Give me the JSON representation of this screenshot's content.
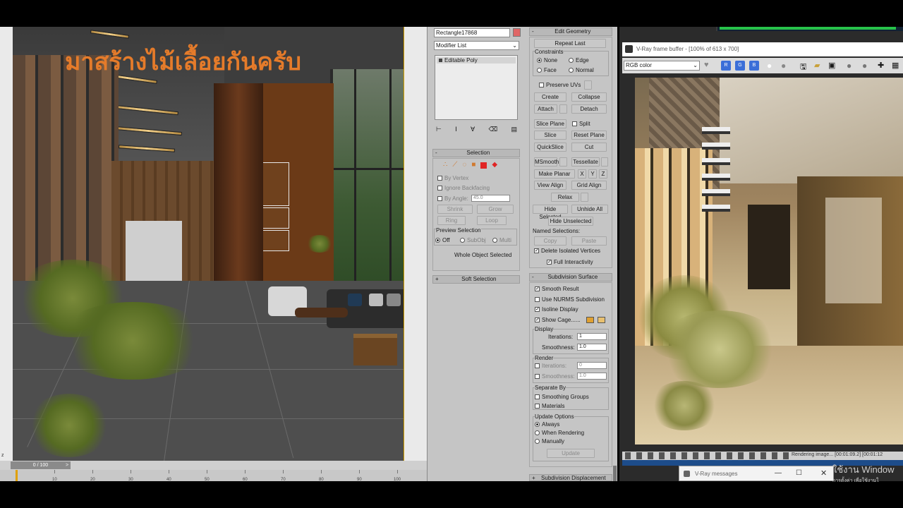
{
  "viewport": {
    "overlay_title": "มาสร้างไม้เลื้อยกันครับ",
    "axis_label": "z"
  },
  "timeline": {
    "frame_indicator": "0 / 100",
    "next_arrow": ">",
    "ticks": [
      "10",
      "20",
      "30",
      "40",
      "50",
      "60",
      "70",
      "80",
      "90",
      "100"
    ]
  },
  "command_panel": {
    "object_name": "Rectangle17868",
    "object_color": "#e06666",
    "modifier_list_label": "Modifier List",
    "modifier_stack": [
      "Editable Poly"
    ],
    "selection": {
      "title": "Selection",
      "by_vertex": "By Vertex",
      "ignore_backfacing": "Ignore Backfacing",
      "by_angle": "By Angle:",
      "by_angle_value": "45.0",
      "shrink": "Shrink",
      "grow": "Grow",
      "ring": "Ring",
      "loop": "Loop",
      "preview_selection": "Preview Selection",
      "preview_off": "Off",
      "preview_subobj": "SubObj",
      "preview_multi": "Multi",
      "status": "Whole Object Selected"
    },
    "soft_selection": {
      "title": "Soft Selection"
    },
    "edit_geometry": {
      "title": "Edit Geometry",
      "repeat_last": "Repeat Last",
      "constraints": "Constraints",
      "none": "None",
      "edge": "Edge",
      "face": "Face",
      "normal": "Normal",
      "preserve_uvs": "Preserve UVs",
      "create": "Create",
      "collapse": "Collapse",
      "attach": "Attach",
      "detach": "Detach",
      "slice_plane": "Slice Plane",
      "split": "Split",
      "slice": "Slice",
      "reset_plane": "Reset Plane",
      "quickslice": "QuickSlice",
      "cut": "Cut",
      "msmooth": "MSmooth",
      "tessellate": "Tessellate",
      "make_planar": "Make Planar",
      "x": "X",
      "y": "Y",
      "z": "Z",
      "view_align": "View Align",
      "grid_align": "Grid Align",
      "relax": "Relax",
      "hide_selected": "Hide Selected",
      "unhide_all": "Unhide All",
      "hide_unselected": "Hide Unselected",
      "named_selections": "Named Selections:",
      "copy": "Copy",
      "paste": "Paste",
      "delete_isolated": "Delete Isolated Vertices",
      "full_interactivity": "Full Interactivity"
    },
    "subdivision_surface": {
      "title": "Subdivision Surface",
      "smooth_result": "Smooth Result",
      "use_nurms": "Use NURMS Subdivision",
      "isoline_display": "Isoline Display",
      "show_cage": "Show Cage......",
      "cage_color_1": "#e0a030",
      "cage_color_2": "#e8c070",
      "display": "Display",
      "iterations": "Iterations:",
      "iterations_value": "1",
      "smoothness": "Smoothness:",
      "smoothness_value": "1.0",
      "render": "Render",
      "render_iterations": "Iterations:",
      "render_iterations_value": "0",
      "render_smoothness": "Smoothness:",
      "render_smoothness_value": "1.0",
      "separate_by": "Separate By",
      "smoothing_groups": "Smoothing Groups",
      "materials": "Materials",
      "update_options": "Update Options",
      "always": "Always",
      "when_rendering": "When Rendering",
      "manually": "Manually",
      "update": "Update"
    },
    "subdivision_displacement": {
      "title": "Subdivision Displacement"
    }
  },
  "vfb": {
    "title": "V-Ray frame buffer - [100% of 613 x 700]",
    "channel": "RGB color",
    "status": "Rendering image... [00:01:09.2] [00:01:12",
    "messages_title": "V-Ray messages",
    "watermark_line1": "ใช้งาน Window",
    "watermark_line2": "การตั้งค่า เพื่อใช้งานใ"
  },
  "colors": {
    "accent_orange": "#e57b2a",
    "progress_green": "#27c24a",
    "vfb_blue_icon": "#3b6fd8"
  }
}
